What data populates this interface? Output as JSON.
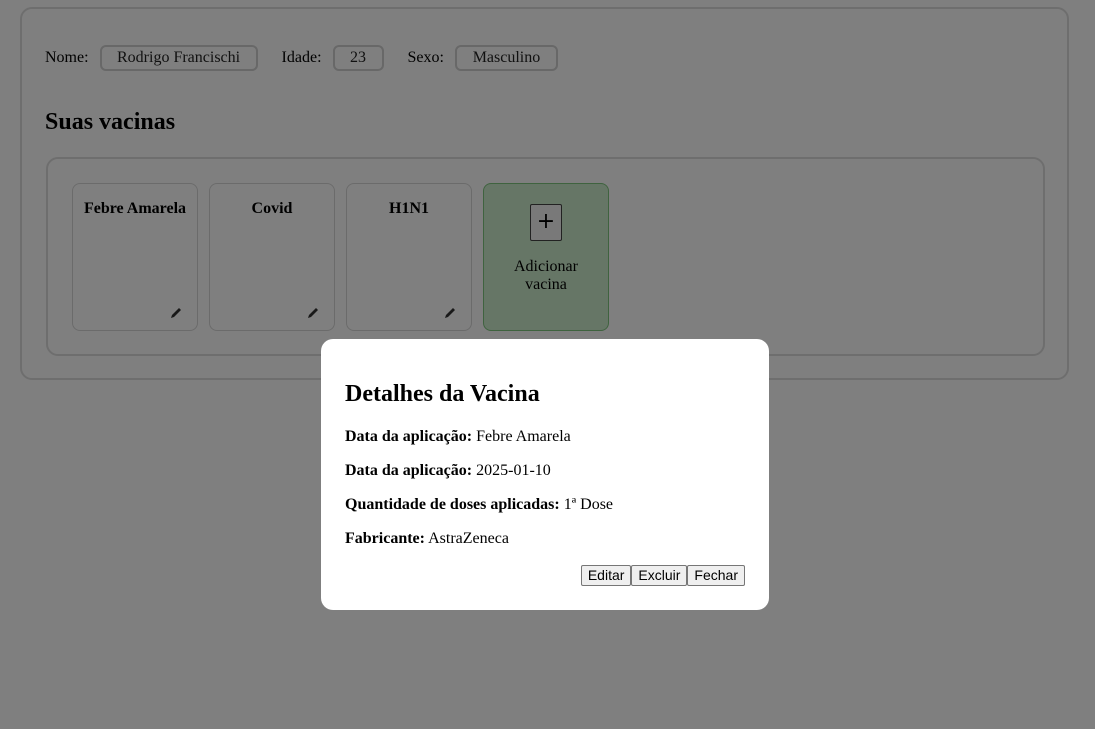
{
  "profile": {
    "name_label": "Nome:",
    "name_value": "Rodrigo Francischi",
    "age_label": "Idade:",
    "age_value": "23",
    "sex_label": "Sexo:",
    "sex_value": "Masculino"
  },
  "vaccines_section": {
    "title": "Suas vacinas",
    "cards": [
      {
        "name": "Febre Amarela",
        "icon": "pencil-icon"
      },
      {
        "name": "Covid",
        "icon": "pencil-icon"
      },
      {
        "name": "H1N1",
        "icon": "pencil-icon"
      }
    ],
    "add_card": {
      "button_symbol": "+",
      "label": "Adicionar vacina",
      "color": "#cdeccd"
    }
  },
  "modal": {
    "title": "Detalhes da Vacina",
    "details": [
      {
        "label": "Data da aplicação:",
        "value": "Febre Amarela"
      },
      {
        "label": "Data da aplicação:",
        "value": "2025-01-10"
      },
      {
        "label": "Quantidade de doses aplicadas:",
        "value": "1ª Dose"
      },
      {
        "label": "Fabricante:",
        "value": "AstraZeneca"
      }
    ],
    "buttons": {
      "edit": "Editar",
      "delete": "Excluir",
      "close": "Fechar"
    }
  },
  "overlay_color": "rgba(0,0,0,0.5)"
}
